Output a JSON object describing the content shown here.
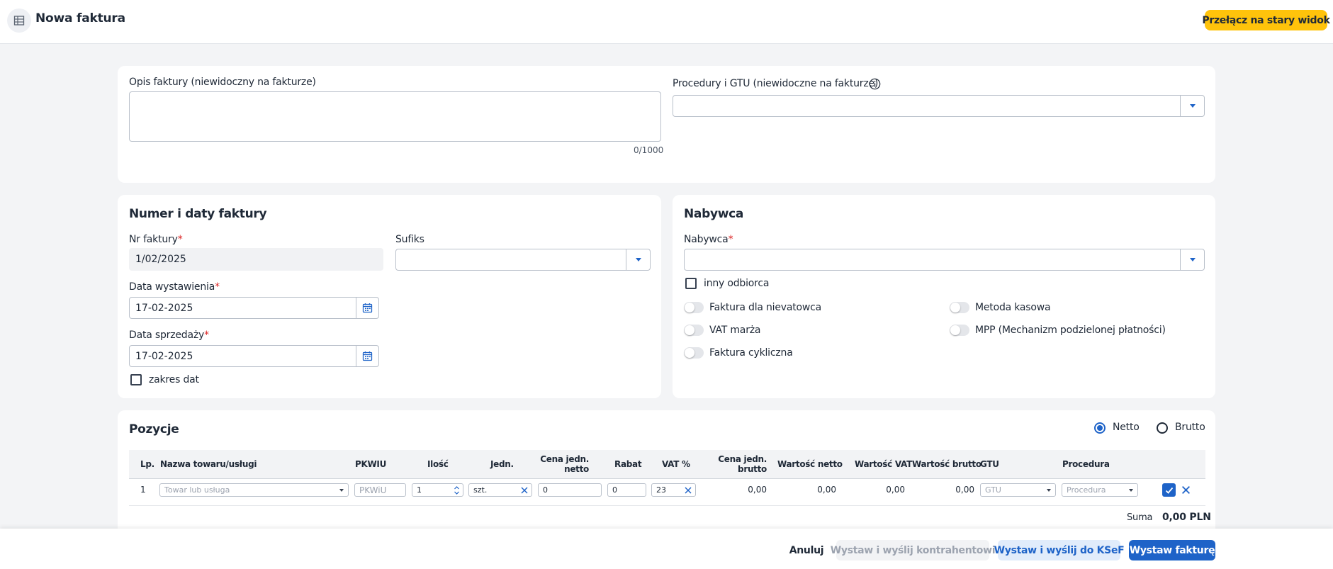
{
  "header": {
    "title": "Nowa faktura",
    "switch_button": "Przełącz na stary widok",
    "app_icon": "building-icon"
  },
  "description_card": {
    "description_label": "Opis faktury (niewidoczny na fakturze)",
    "description_value": "",
    "char_counter": "0/1000",
    "gtu_label": "Procedury i GTU (niewidoczne na fakturze)",
    "gtu_value": ""
  },
  "numbering": {
    "title": "Numer i daty faktury",
    "invoice_no_label": "Nr faktury",
    "invoice_no_value": "1/02/2025",
    "suffix_label": "Sufiks",
    "suffix_value": "",
    "issue_date_label": "Data wystawienia",
    "issue_date_value": "17-02-2025",
    "sale_date_label": "Data sprzedaży",
    "sale_date_value": "17-02-2025",
    "date_range_label": "zakres dat",
    "required_mark": "*"
  },
  "buyer": {
    "title": "Nabywca",
    "buyer_label": "Nabywca",
    "buyer_value": "",
    "other_recipient_label": "inny odbiorca",
    "toggles": [
      {
        "label": "Faktura dla nievatowca",
        "on": false
      },
      {
        "label": "Metoda kasowa",
        "on": false
      },
      {
        "label": "VAT marża",
        "on": false
      },
      {
        "label": "MPP (Mechanizm podzielonej płatności)",
        "on": false
      },
      {
        "label": "Faktura cykliczna",
        "on": false
      }
    ]
  },
  "items": {
    "title": "Pozycje",
    "netto_label": "Netto",
    "brutto_label": "Brutto",
    "selected_mode": "Netto",
    "columns": {
      "lp": "Lp.",
      "name": "Nazwa towaru/usługi",
      "pkwiu": "PKWIU",
      "qty": "Ilość",
      "unit": "Jedn.",
      "unit_net_1": "Cena jedn.",
      "unit_net_2": "netto",
      "discount": "Rabat",
      "vat": "VAT %",
      "unit_gross_1": "Cena jedn.",
      "unit_gross_2": "brutto",
      "net_value": "Wartość netto",
      "vat_value": "Wartość VAT",
      "gross_value": "Wartość brutto",
      "gtu": "GTU",
      "procedure": "Procedura"
    },
    "rows": [
      {
        "lp": "1",
        "name_placeholder": "Towar lub usługa",
        "pkwiu_placeholder": "PKWiU",
        "qty": "1",
        "unit": "szt.",
        "unit_net_price": "0",
        "discount": "0",
        "vat": "23",
        "unit_gross_price": "0,00",
        "net_value": "0,00",
        "vat_value": "0,00",
        "gross_value": "0,00",
        "gtu_placeholder": "GTU",
        "procedure_placeholder": "Procedura"
      }
    ],
    "sum_label": "Suma",
    "sum_value": "0,00 PLN"
  },
  "footer": {
    "cancel": "Anuluj",
    "issue_send_contractor": "Wystaw i wyślij kontrahentowi",
    "issue_send_ksef": "Wystaw i wyślij do KSeF",
    "issue": "Wystaw fakturę"
  },
  "colors": {
    "accent": "#1e63c8",
    "warning_button": "#ffc30b",
    "required": "#dc2626"
  }
}
